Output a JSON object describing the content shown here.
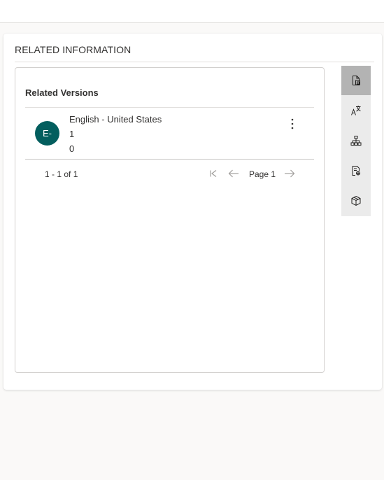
{
  "panel": {
    "title": "RELATED INFORMATION"
  },
  "related_versions": {
    "title": "Related Versions",
    "items": [
      {
        "avatar_initials": "E-",
        "avatar_color": "#035e5e",
        "language": "English - United States",
        "line2": "1",
        "line3": "0",
        "more_icon": "more-vertical-icon"
      }
    ],
    "pager": {
      "count_text": "1 - 1 of 1",
      "page_label": "Page 1",
      "first_icon": "first-page-icon",
      "prev_icon": "arrow-left-icon",
      "next_icon": "arrow-right-icon"
    }
  },
  "side_rail": {
    "items": [
      {
        "icon": "document-related-icon",
        "active": true
      },
      {
        "icon": "translate-icon",
        "active": false
      },
      {
        "icon": "hierarchy-icon",
        "active": false
      },
      {
        "icon": "document-analysis-icon",
        "active": false
      },
      {
        "icon": "package-icon",
        "active": false
      }
    ]
  },
  "colors": {
    "accent_avatar": "#035e5e",
    "rail_background": "#ebebeb",
    "rail_active": "#b3b3b3",
    "page_background": "#faf9f8"
  }
}
